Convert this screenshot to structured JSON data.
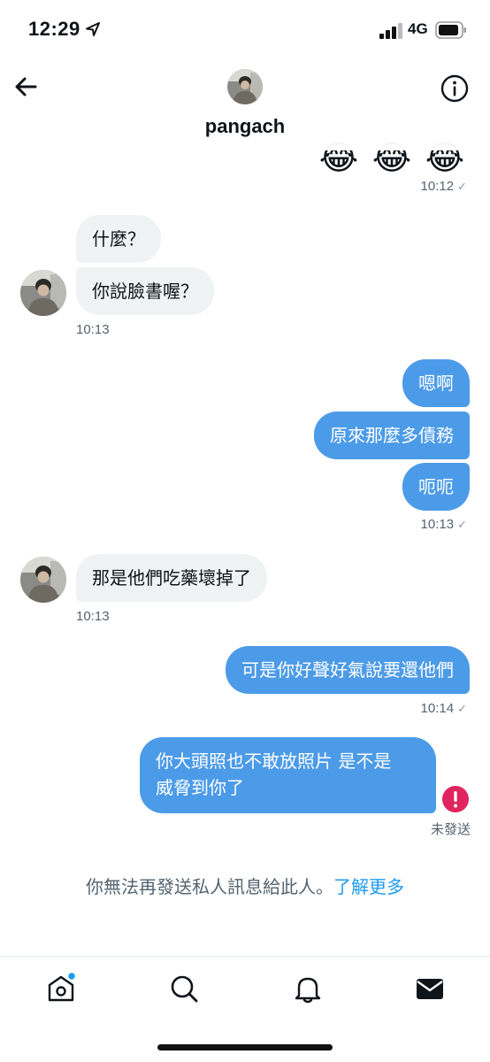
{
  "status_bar": {
    "time": "12:29",
    "network": "4G"
  },
  "header": {
    "username": "pangach"
  },
  "messages": {
    "m1_time": "10:12",
    "m2_text": "什麼？",
    "m3_text": "你說臉書喔？",
    "m3_time": "10:13",
    "m4_text": "嗯啊",
    "m5_text": "原來那麼多債務",
    "m6_text": "呃呃",
    "m6_time": "10:13",
    "m7_text": "那是他們吃藥壞掉了",
    "m7_time": "10:13",
    "m8_text": "可是你好聲好氣說要還他們",
    "m8_time": "10:14",
    "m9_line1": "你大頭照也不敢放照片 是不是",
    "m9_line2": "威脅到你了",
    "m9_status": "未發送",
    "check": "✓"
  },
  "notice": {
    "text": "你無法再發送私人訊息給此人。",
    "link": "了解更多"
  },
  "colors": {
    "outgoing": "#4c9be8",
    "incoming": "#eff3f4",
    "accent": "#1d9bf0",
    "error": "#e0245e"
  },
  "icons": {
    "back": "arrow-left-icon",
    "info": "info-icon",
    "home": "home-icon",
    "search": "search-icon",
    "notifications": "bell-icon",
    "messages": "mail-icon"
  }
}
